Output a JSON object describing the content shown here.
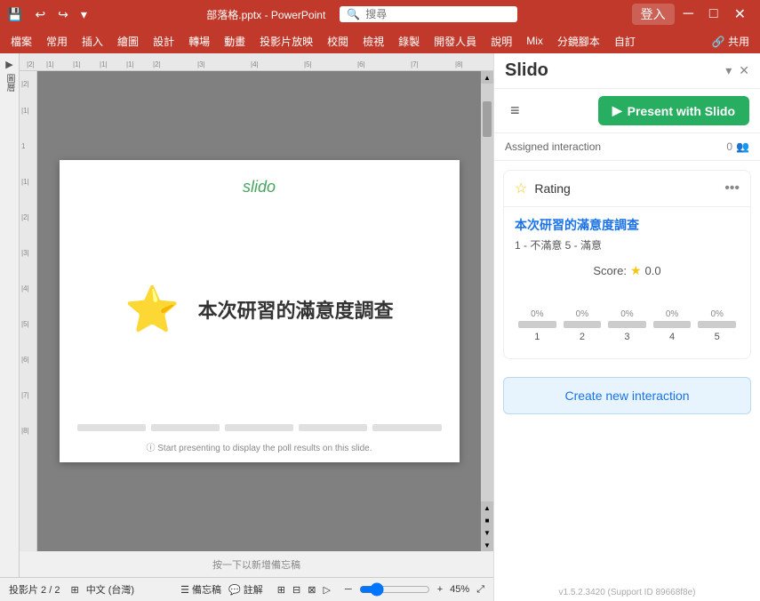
{
  "titlebar": {
    "save_icon": "💾",
    "undo_icon": "↩",
    "redo_icon": "↪",
    "dropdown_icon": "▾",
    "filename": "部落格.pptx - PowerPoint",
    "search_placeholder": "搜尋",
    "login_label": "登入",
    "minimize_icon": "─",
    "maximize_icon": "□",
    "close_icon": "✕"
  },
  "menubar": {
    "items": [
      "檔案",
      "常用",
      "插入",
      "繪圖",
      "設計",
      "轉場",
      "動畫",
      "投影片放映",
      "校閱",
      "檢視",
      "錄製",
      "開發人員",
      "說明",
      "Mix",
      "分鏡腳本",
      "自訂"
    ]
  },
  "slide": {
    "slido_logo": "slido",
    "star_icon": "☆",
    "title": "本次研習的滿意度調查",
    "footer_note": "ⓘ Start presenting to display the poll results on this slide."
  },
  "statusbar": {
    "slide_info": "投影片 2 / 2",
    "language": "中文 (台灣)",
    "notes_label": "備忘稿",
    "comments_label": "註解",
    "zoom": "45%"
  },
  "slido": {
    "title": "Slido",
    "dropdown_icon": "▾",
    "close_icon": "✕",
    "hamburger": "≡",
    "present_btn": "Present with Slido",
    "present_icon": "▶",
    "assigned_label": "Assigned interaction",
    "assigned_count": "0",
    "assigned_icon": "👥",
    "rating_card": {
      "star_icon": "☆",
      "title": "Rating",
      "more_icon": "•••",
      "question": "本次研習的滿意度調查",
      "scale": "1 - 不滿意  5 - 滿意",
      "score_label": "Score:",
      "score_star": "★",
      "score_value": "0.0",
      "bars": [
        {
          "pct": "0%",
          "label": "1"
        },
        {
          "pct": "0%",
          "label": "2"
        },
        {
          "pct": "0%",
          "label": "3"
        },
        {
          "pct": "0%",
          "label": "4"
        },
        {
          "pct": "0%",
          "label": "5"
        }
      ]
    },
    "create_btn": "Create new interaction",
    "version": "v1.5.2.3420 (Support ID 89668f8e)"
  }
}
